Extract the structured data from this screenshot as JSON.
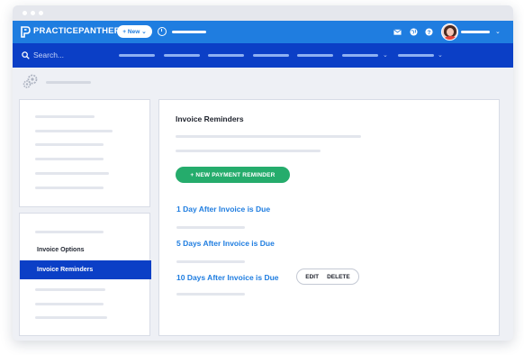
{
  "app": {
    "brand_name": "PRACTICEPANTHER",
    "trademark": "®",
    "new_button_label": "+ New",
    "new_button_caret": "⌄"
  },
  "colors": {
    "primary_blue": "#1f7de0",
    "nav_blue": "#0b3fc6",
    "success_green": "#25ac6c",
    "page_bg": "#eef0f5"
  },
  "header_icons": [
    "mail-icon",
    "globe-icon",
    "help-icon"
  ],
  "navbar": {
    "search_placeholder": "Search...",
    "caret": "⌄"
  },
  "sidebar": {
    "settings_items": [
      {
        "label": "Invoice Options",
        "active": false
      },
      {
        "label": "Invoice Reminders",
        "active": true
      }
    ]
  },
  "main": {
    "title": "Invoice Reminders",
    "new_reminder_button": "+ NEW PAYMENT REMINDER",
    "reminders": [
      {
        "label": "1 Day After Invoice is Due"
      },
      {
        "label": "5 Days After Invoice is Due"
      },
      {
        "label": "10 Days After Invoice is Due"
      }
    ],
    "row_actions": {
      "edit_label": "EDIT",
      "delete_label": "DELETE"
    }
  }
}
